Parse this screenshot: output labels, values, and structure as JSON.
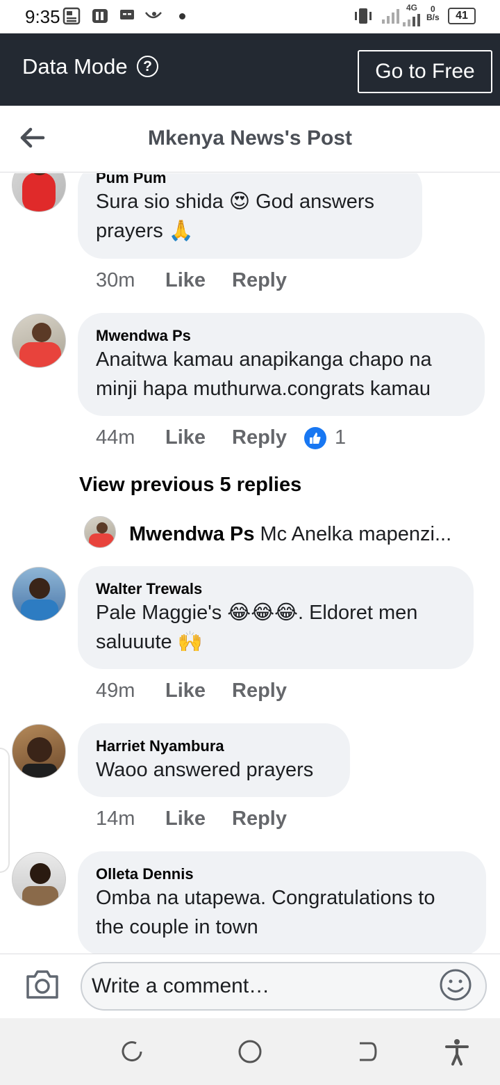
{
  "status_bar": {
    "time": "9:35",
    "network_type": "4G",
    "data_rate_value": "0",
    "data_rate_unit": "B/s",
    "battery": "41"
  },
  "data_mode": {
    "label": "Data Mode",
    "help_icon": "?",
    "button_label": "Go to Free"
  },
  "header": {
    "title": "Mkenya News's Post"
  },
  "comments": [
    {
      "name": "Pum Pum",
      "text": "Sura sio shida 😍 God answers prayers 🙏",
      "time": "30m",
      "like": "Like",
      "reply": "Reply"
    },
    {
      "name": "Mwendwa Ps",
      "text": "Anaitwa kamau anapikanga chapo na minji hapa muthurwa.congrats kamau",
      "time": "44m",
      "like": "Like",
      "reply": "Reply",
      "reaction_count": "1"
    },
    {
      "name": "Walter Trewals",
      "text": "Pale Maggie's 😂😂😂. Eldoret men saluuute 🙌",
      "time": "49m",
      "like": "Like",
      "reply": "Reply"
    },
    {
      "name": "Harriet Nyambura",
      "text": "Waoo answered prayers",
      "time": "14m",
      "like": "Like",
      "reply": "Reply"
    },
    {
      "name": "Olleta Dennis",
      "text": "Omba na utapewa. Congratulations to the couple in town"
    }
  ],
  "replies": {
    "view_previous_label": "View previous 5 replies",
    "preview_name": "Mwendwa Ps",
    "preview_text": "Mc Anelka mapenzi..."
  },
  "composer": {
    "placeholder": "Write a comment…"
  },
  "icons": {
    "back": "arrow-left-icon",
    "camera": "camera-icon",
    "emoji": "smiley-icon",
    "like_reaction": "thumbs-up-icon"
  },
  "colors": {
    "data_bar": "#232932",
    "bubble": "#f0f2f5",
    "like_blue": "#1877f2",
    "meta_gray": "#65676b"
  }
}
